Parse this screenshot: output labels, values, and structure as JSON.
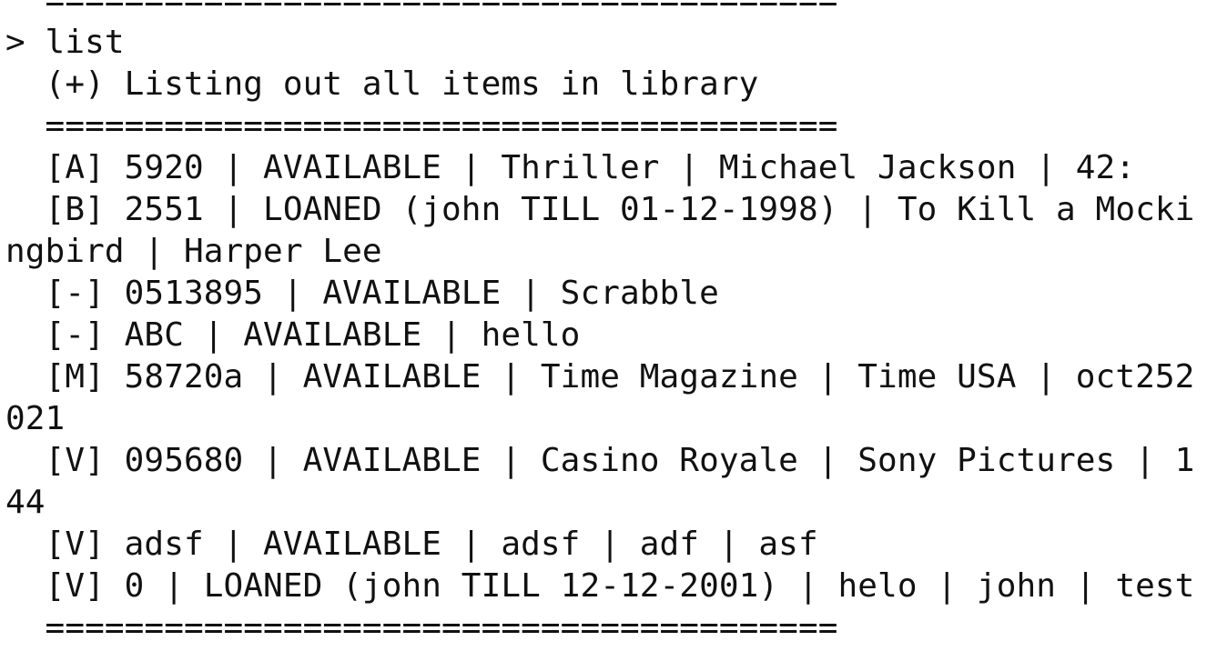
{
  "terminal": {
    "lines": [
      "  ========================================",
      "> list",
      "  (+) Listing out all items in library",
      "  ========================================",
      "  [A] 5920 | AVAILABLE | Thriller | Michael Jackson | 42:",
      "  [B] 2551 | LOANED (john TILL 01-12-1998) | To Kill a Mocki",
      "ngbird | Harper Lee",
      "  [-] 0513895 | AVAILABLE | Scrabble",
      "  [-] ABC | AVAILABLE | hello",
      "  [M] 58720a | AVAILABLE | Time Magazine | Time USA | oct252",
      "021",
      "  [V] 095680 | AVAILABLE | Casino Royale | Sony Pictures | 1",
      "44",
      "  [V] adsf | AVAILABLE | adsf | adf | asf",
      "  [V] 0 | LOANED (john TILL 12-12-2001) | helo | john | test",
      "  ========================================"
    ]
  }
}
